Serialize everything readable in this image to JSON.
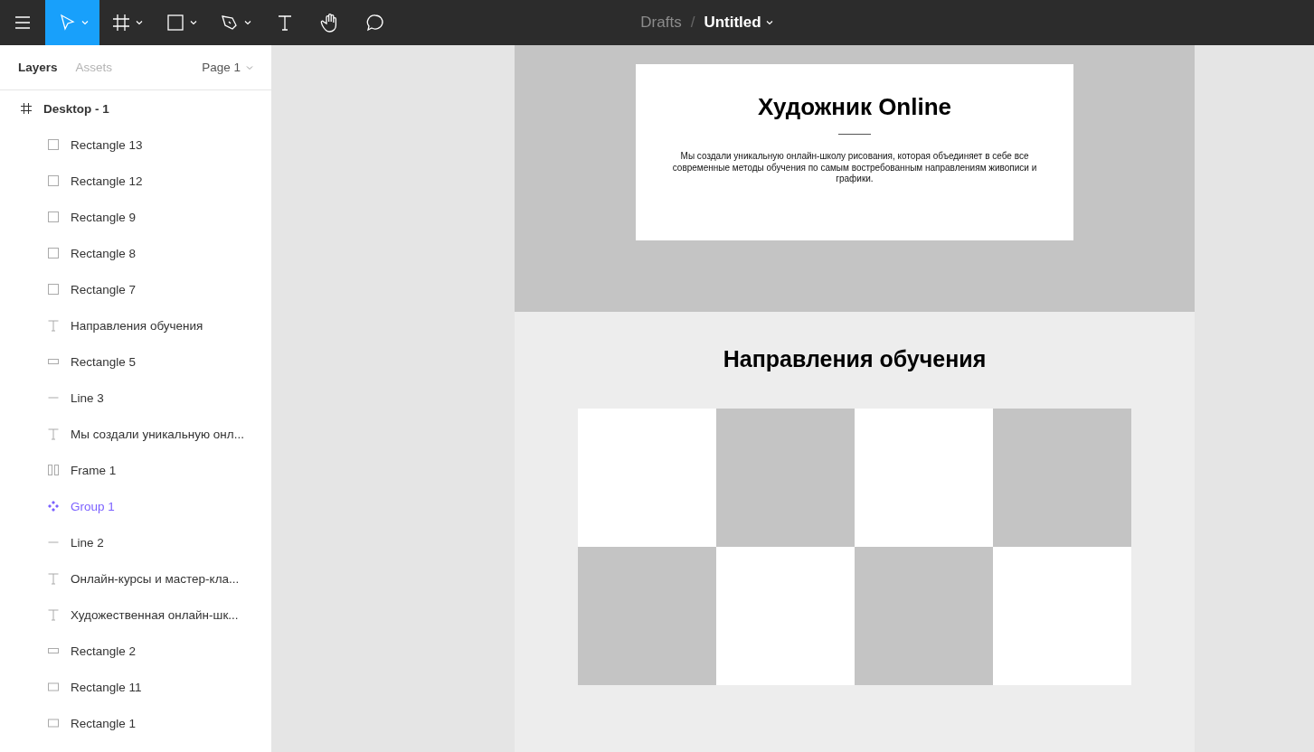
{
  "toolbar": {
    "tools": [
      {
        "kind": "menu",
        "selected": false,
        "caret": false
      },
      {
        "kind": "move",
        "selected": true,
        "caret": true
      },
      {
        "kind": "frame",
        "selected": false,
        "caret": true
      },
      {
        "kind": "rectangle",
        "selected": false,
        "caret": true
      },
      {
        "kind": "pen",
        "selected": false,
        "caret": true
      },
      {
        "kind": "text",
        "selected": false,
        "caret": false
      },
      {
        "kind": "hand",
        "selected": false,
        "caret": false
      },
      {
        "kind": "comment",
        "selected": false,
        "caret": false
      }
    ],
    "breadcrumb": {
      "folder": "Drafts",
      "separator": "/",
      "file": "Untitled"
    }
  },
  "sidebar": {
    "tabs": [
      {
        "label": "Layers",
        "selected": true
      },
      {
        "label": "Assets",
        "selected": false
      }
    ],
    "page": "Page 1",
    "layers": [
      {
        "kind": "frame",
        "name": "Desktop - 1",
        "children": [
          {
            "kind": "square",
            "name": "Rectangle 13"
          },
          {
            "kind": "square",
            "name": "Rectangle 12"
          },
          {
            "kind": "square",
            "name": "Rectangle 9"
          },
          {
            "kind": "square",
            "name": "Rectangle 8"
          },
          {
            "kind": "square",
            "name": "Rectangle 7"
          },
          {
            "kind": "text",
            "name": "Направления обучения"
          },
          {
            "kind": "bar",
            "name": "Rectangle 5"
          },
          {
            "kind": "line",
            "name": "Line 3"
          },
          {
            "kind": "text",
            "name": "Мы создали уникальную онл..."
          },
          {
            "kind": "columns",
            "name": "Frame 1"
          },
          {
            "kind": "component",
            "name": "Group 1"
          },
          {
            "kind": "line",
            "name": "Line 2"
          },
          {
            "kind": "text",
            "name": "Онлайн-курсы и мастер-кла..."
          },
          {
            "kind": "text",
            "name": "Художественная онлайн-шк..."
          },
          {
            "kind": "bar",
            "name": "Rectangle 2"
          },
          {
            "kind": "wide",
            "name": "Rectangle 11"
          },
          {
            "kind": "wide",
            "name": "Rectangle 1"
          }
        ]
      }
    ]
  },
  "canvas": {
    "hero": {
      "title": "Художник Online",
      "text": "Мы создали уникальную онлайн-школу рисования, которая объединяет в себе все современные методы обучения по самым востребованным направлениям живописи и графики."
    },
    "section": {
      "title": "Направления обучения",
      "tiles": [
        {
          "color": "#ffffff"
        },
        {
          "color": "#c4c4c4"
        },
        {
          "color": "#ffffff"
        },
        {
          "color": "#c4c4c4"
        },
        {
          "color": "#c4c4c4"
        },
        {
          "color": "#ffffff"
        },
        {
          "color": "#c4c4c4"
        },
        {
          "color": "#ffffff"
        }
      ]
    }
  }
}
